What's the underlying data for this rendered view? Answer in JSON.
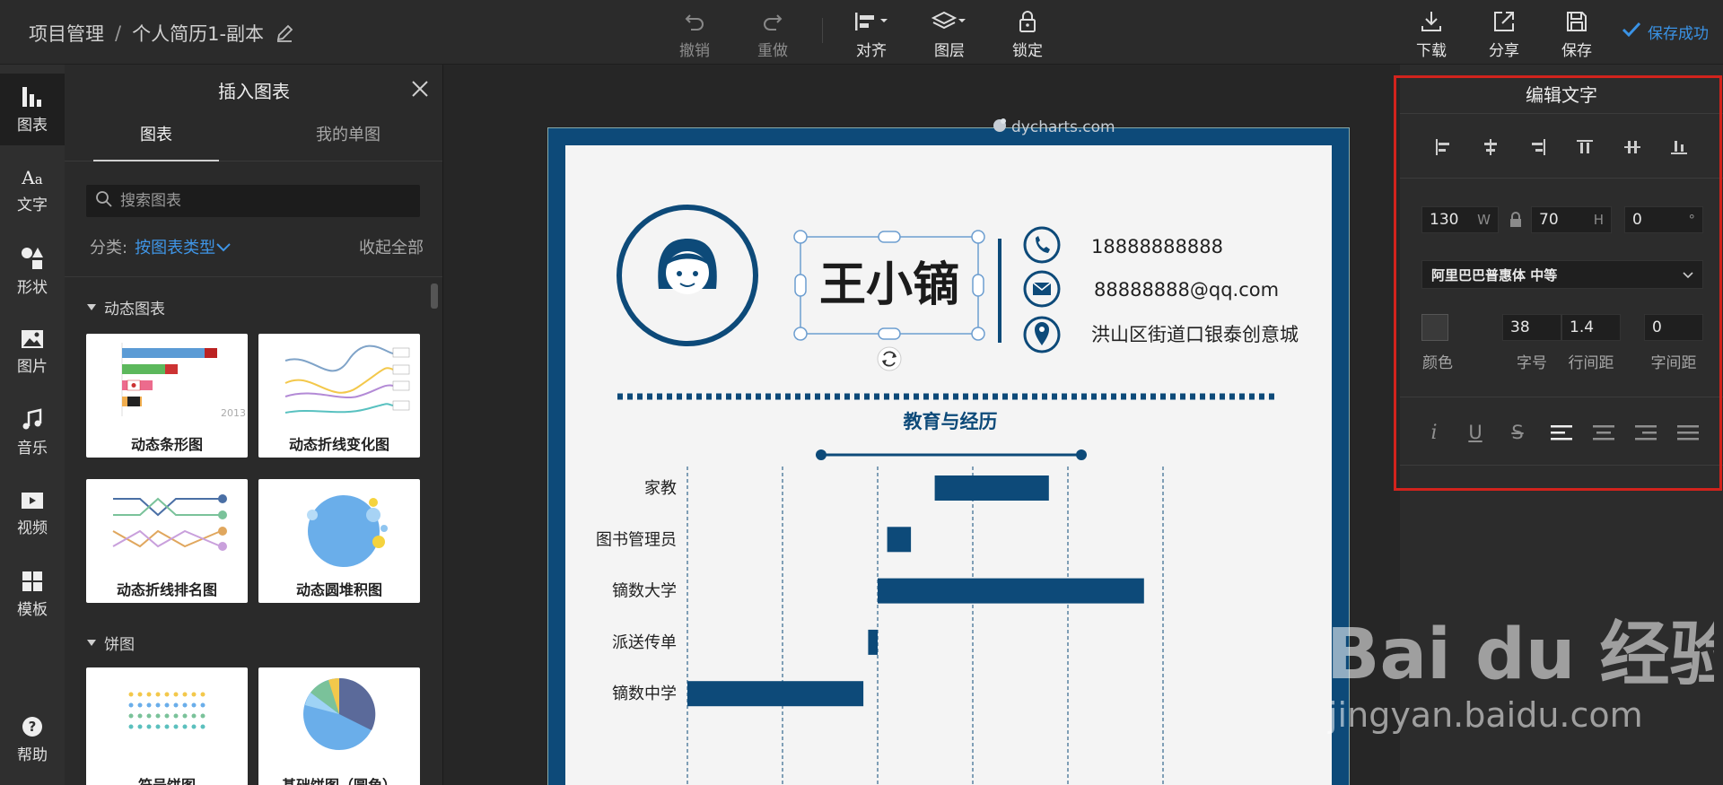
{
  "header": {
    "breadcrumb_root": "项目管理",
    "breadcrumb_sep": "/",
    "doc_name": "个人简历1-副本",
    "tools": {
      "undo": "撤销",
      "redo": "重做",
      "align": "对齐",
      "layer": "图层",
      "lock": "锁定",
      "download": "下载",
      "share": "分享",
      "save": "保存"
    },
    "save_status": "保存成功"
  },
  "rail": {
    "items": [
      {
        "label": "图表",
        "icon": "bar-chart-icon"
      },
      {
        "label": "文字",
        "icon": "text-icon"
      },
      {
        "label": "形状",
        "icon": "shapes-icon"
      },
      {
        "label": "图片",
        "icon": "image-icon"
      },
      {
        "label": "音乐",
        "icon": "music-icon"
      },
      {
        "label": "视频",
        "icon": "video-icon"
      },
      {
        "label": "模板",
        "icon": "template-icon"
      }
    ],
    "help": "帮助"
  },
  "panel": {
    "title": "插入图表",
    "tabs": [
      "图表",
      "我的单图"
    ],
    "search_placeholder": "搜索图表",
    "filter_key": "分类:",
    "filter_value": "按图表类型",
    "collapse_all": "收起全部",
    "sections": [
      {
        "name": "动态图表",
        "cards": [
          "动态条形图",
          "动态折线变化图",
          "动态折线排名图",
          "动态圆堆积图"
        ]
      },
      {
        "name": "饼图",
        "cards": [
          "符号饼图",
          "基础饼图（圆角）"
        ]
      }
    ],
    "thumb_year": "2013"
  },
  "resume": {
    "name": "王小镝",
    "phone": "18888888888",
    "email": "88888888@qq.com",
    "address": "洪山区街道口银泰创意城",
    "section_title": "教育与经历",
    "brand_watermark": "dycharts.com"
  },
  "chart_data": {
    "type": "bar",
    "orientation": "horizontal-range",
    "categories": [
      "家教",
      "图书管理员",
      "镝数大学",
      "派送传单",
      "镝数中学"
    ],
    "series": [
      {
        "values": [
          [
            2.6,
            3.8
          ],
          [
            2.1,
            2.35
          ],
          [
            2.0,
            4.8
          ],
          [
            1.9,
            2.0
          ],
          [
            0.0,
            1.85
          ]
        ]
      }
    ],
    "xlim": [
      0,
      5
    ],
    "grid": "vertical-dashed",
    "color": "#0d4a79"
  },
  "edit_text": {
    "title": "编辑文字",
    "width": "130",
    "width_unit": "W",
    "height": "70",
    "height_unit": "H",
    "rotation": "0",
    "rotation_unit": "°",
    "font": "阿里巴巴普惠体 中等",
    "font_size": "38",
    "line_height": "1.4",
    "letter_spacing": "0",
    "labels": {
      "color": "颜色",
      "size": "字号",
      "line": "行间距",
      "spacing": "字间距"
    },
    "style_buttons": [
      "i",
      "U",
      "S"
    ]
  },
  "colors": {
    "accent": "#3a93e6",
    "resume_blue": "#0d4a79",
    "highlight_frame": "#d2231d"
  },
  "watermark": {
    "brand": "Bai du 经验",
    "url": "jingyan.baidu.com"
  }
}
